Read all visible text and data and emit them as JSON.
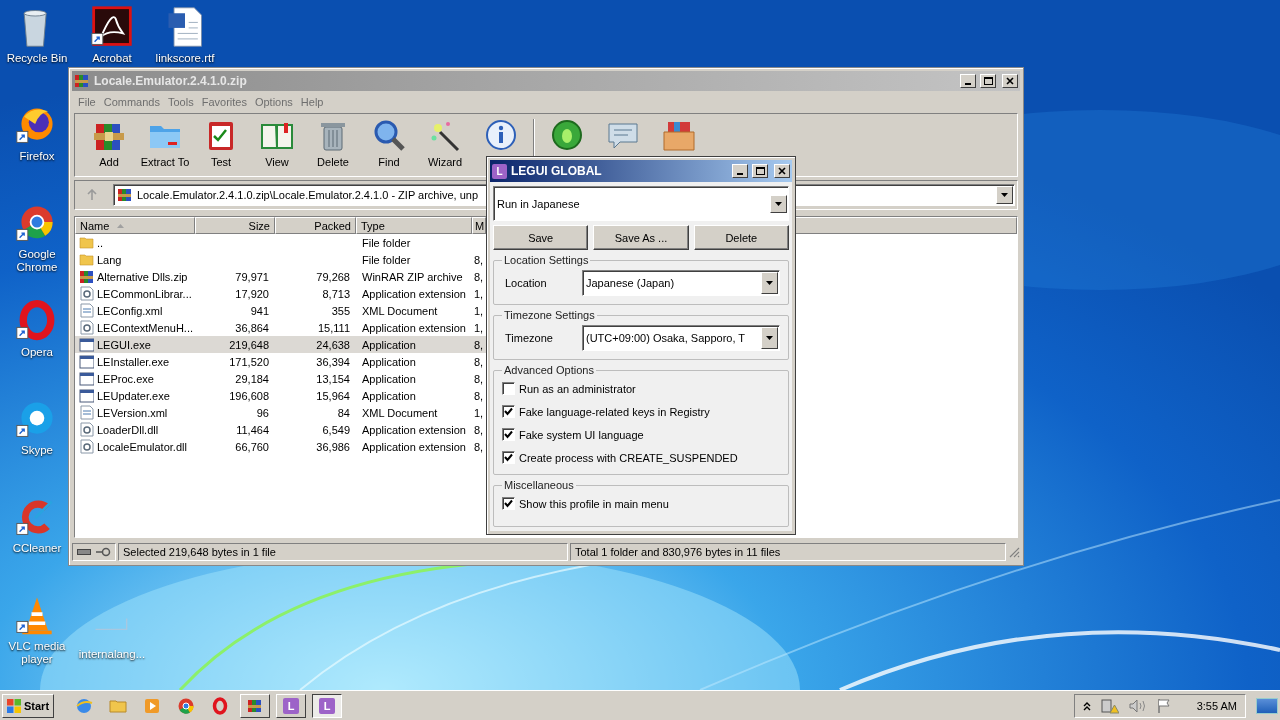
{
  "desktop": {
    "left_column": [
      {
        "label": "Recycle Bin"
      },
      {
        "label": "Firefox"
      },
      {
        "label": "Google Chrome"
      },
      {
        "label": "Opera"
      },
      {
        "label": "Skype"
      },
      {
        "label": "CCleaner"
      },
      {
        "label": "VLC media player"
      }
    ],
    "top_row": [
      {
        "label": "Acrobat"
      },
      {
        "label": "linkscore.rtf"
      }
    ],
    "bottom_row": [
      {
        "label": "internalang..."
      }
    ]
  },
  "archiver": {
    "title": "Locale.Emulator.2.4.1.0.zip",
    "menu": [
      "File",
      "Commands",
      "Tools",
      "Favorites",
      "Options",
      "Help"
    ],
    "toolbar": [
      "Add",
      "Extract To",
      "Test",
      "View",
      "Delete",
      "Find",
      "Wizard"
    ],
    "address": "Locale.Emulator.2.4.1.0.zip\\Locale.Emulator.2.4.1.0 - ZIP archive, unp",
    "columns": [
      {
        "label": "Name",
        "sorted": true
      },
      {
        "label": "Size",
        "sorted": false
      },
      {
        "label": "Packed",
        "sorted": false
      },
      {
        "label": "Type",
        "sorted": false
      },
      {
        "label": "M",
        "sorted": false
      }
    ],
    "rows": [
      {
        "kind": "folder",
        "name": "..",
        "type": "File folder",
        "selected": false
      },
      {
        "kind": "folder",
        "name": "Lang",
        "type": "File folder",
        "column_5": "8,",
        "selected": false
      },
      {
        "kind": "archive",
        "name": "Alternative Dlls.zip",
        "size": "79,971",
        "packed": "79,268",
        "type": "WinRAR ZIP archive",
        "column_5": "8,",
        "selected": false
      },
      {
        "kind": "library",
        "name": "LECommonLibrar...",
        "size": "17,920",
        "packed": "8,713",
        "type": "Application extension",
        "column_5": "1,",
        "selected": false
      },
      {
        "kind": "document",
        "name": "LEConfig.xml",
        "size": "941",
        "packed": "355",
        "type": "XML Document",
        "column_5": "1,",
        "selected": false
      },
      {
        "kind": "library",
        "name": "LEContextMenuH...",
        "size": "36,864",
        "packed": "15,111",
        "type": "Application extension",
        "column_5": "1,",
        "selected": false
      },
      {
        "kind": "program",
        "name": "LEGUI.exe",
        "size": "219,648",
        "packed": "24,638",
        "type": "Application",
        "column_5": "8,",
        "selected": true
      },
      {
        "kind": "program",
        "name": "LEInstaller.exe",
        "size": "171,520",
        "packed": "36,394",
        "type": "Application",
        "column_5": "8,",
        "selected": false
      },
      {
        "kind": "program",
        "name": "LEProc.exe",
        "size": "29,184",
        "packed": "13,154",
        "type": "Application",
        "column_5": "8,",
        "selected": false
      },
      {
        "kind": "program",
        "name": "LEUpdater.exe",
        "size": "196,608",
        "packed": "15,964",
        "type": "Application",
        "column_5": "8,",
        "selected": false
      },
      {
        "kind": "document",
        "name": "LEVersion.xml",
        "size": "96",
        "packed": "84",
        "type": "XML Document",
        "column_5": "1,",
        "selected": false
      },
      {
        "kind": "library",
        "name": "LoaderDll.dll",
        "size": "11,464",
        "packed": "6,549",
        "type": "Application extension",
        "column_5": "8,",
        "selected": false
      },
      {
        "kind": "library",
        "name": "LocaleEmulator.dll",
        "size": "66,760",
        "packed": "36,986",
        "type": "Application extension",
        "column_5": "8,",
        "selected": false
      }
    ],
    "status_left": "Selected 219,648 bytes in 1 file",
    "status_right": "Total 1 folder and 830,976 bytes in 11 files"
  },
  "dialog": {
    "icon_letter": "L",
    "title": "LEGUI GLOBAL",
    "profile": "Run in Japanese",
    "buttons": [
      "Save",
      "Save As ...",
      "Delete"
    ],
    "groups": [
      {
        "kind": "select",
        "title": "Location Settings",
        "label": "Location",
        "value": "Japanese (Japan)"
      },
      {
        "kind": "select",
        "title": "Timezone Settings",
        "label": "Timezone",
        "value": "(UTC+09:00) Osaka, Sapporo, T"
      },
      {
        "kind": "checks",
        "title": "Advanced Options",
        "options": [
          {
            "label": "Run as an administrator",
            "checked": false
          },
          {
            "label": "Fake language-related keys in Registry",
            "checked": true
          },
          {
            "label": "Fake system UI language",
            "checked": true
          },
          {
            "label": "Create process with CREATE_SUSPENDED",
            "checked": true
          }
        ]
      },
      {
        "kind": "checks",
        "title": "Miscellaneous",
        "options": [
          {
            "label": "Show this profile in main menu",
            "checked": true
          }
        ]
      }
    ]
  },
  "taskbar": {
    "start": "Start",
    "buttons": [
      {
        "kind": "pinned",
        "selected": false
      },
      {
        "kind": "pinned",
        "selected": false
      },
      {
        "kind": "pinned",
        "selected": false
      },
      {
        "kind": "pinned",
        "selected": false
      },
      {
        "kind": "pinned",
        "selected": false
      },
      {
        "kind": "window",
        "selected": false
      },
      {
        "kind": "window",
        "letter": "L",
        "selected": false
      },
      {
        "kind": "window",
        "letter": "L",
        "selected": true
      }
    ],
    "clock": "3:55 AM"
  }
}
